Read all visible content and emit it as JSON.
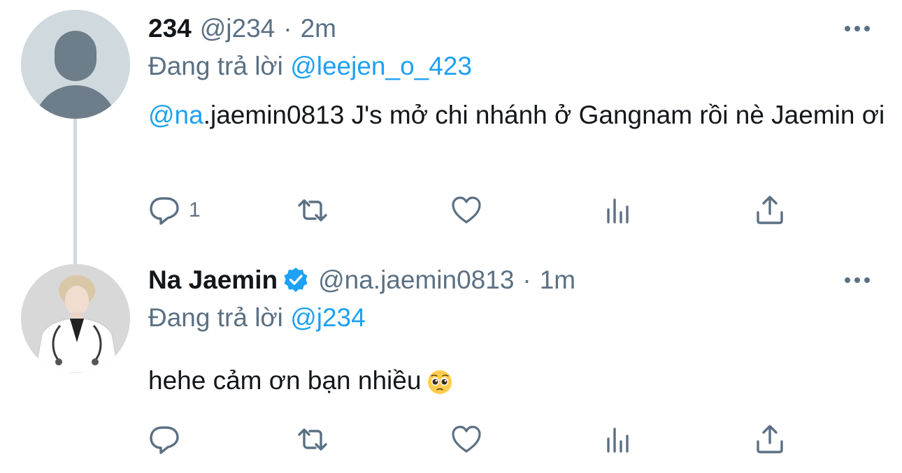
{
  "tweets": [
    {
      "name": "234",
      "handle": "@j234",
      "separator": "·",
      "time": "2m",
      "replying_prefix": "Đang trả lời",
      "replying_to": "@leejen_o_423",
      "text_mention_a": "@na",
      "text_after_mention": ".jaemin0813 J's mở chi nhánh ở Gangnam rồi nè Jaemin ơi",
      "reply_count": "1",
      "verified": false,
      "avatar": "default-profile-icon"
    },
    {
      "name": "Na Jaemin",
      "handle": "@na.jaemin0813",
      "separator": "·",
      "time": "1m",
      "replying_prefix": "Đang trả lời",
      "replying_to": "@j234",
      "text": "hehe cảm ơn bạn nhiều",
      "emoji": "pleading-face-emoji",
      "reply_count": "",
      "verified": true,
      "avatar": "profile-photo"
    }
  ],
  "colors": {
    "text": "#14171a",
    "secondary": "#5b7083",
    "accent": "#1da1f2",
    "thread_line": "#cfd9de"
  },
  "icons": {
    "reply": "reply-icon",
    "retweet": "retweet-icon",
    "like": "heart-icon",
    "analytics": "analytics-icon",
    "share": "share-icon",
    "more": "more-icon"
  }
}
